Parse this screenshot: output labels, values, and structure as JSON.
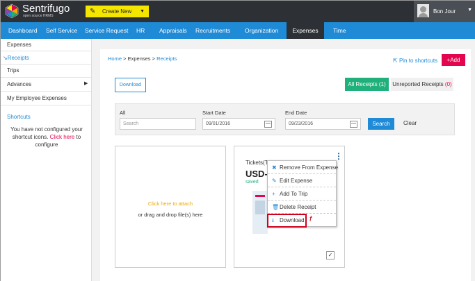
{
  "brand": {
    "name": "Sentrifugo",
    "tagline": "open source HRMS"
  },
  "header": {
    "create_label": "Create New",
    "user_name": "Bon Jour"
  },
  "nav": {
    "items": [
      "Dashboard",
      "Self Service",
      "Service Request",
      "HR",
      "Appraisals",
      "Recruitments",
      "Organization",
      "Expenses",
      "Time"
    ],
    "active": "Expenses"
  },
  "sidebar": {
    "items": [
      "Expenses",
      "Receipts",
      "Trips",
      "Advances",
      "My Employee Expenses"
    ],
    "active": "Receipts",
    "shortcuts_title": "Shortcuts",
    "shortcuts_text_1": "You have not configured your shortcut icons.",
    "shortcuts_link": "Click here",
    "shortcuts_text_2": "to configure"
  },
  "breadcrumb": {
    "home": "Home",
    "sep1": ">",
    "section": "Expenses",
    "sep2": ">",
    "current": "Receipts"
  },
  "actions": {
    "pin_label": "Pin to shortcuts",
    "add_label": "Add",
    "download_label": "Download"
  },
  "tabs": {
    "all_label": "All Receipts",
    "all_count": "(1)",
    "unreported_label": "Unreported Receipts",
    "unreported_count": "(0)"
  },
  "filter": {
    "all_label": "All",
    "search_placeholder": "Search",
    "start_label": "Start Date",
    "start_value": "09/01/2016",
    "end_label": "End Date",
    "end_value": "09/23/2016",
    "search_button": "Search",
    "clear_button": "Clear"
  },
  "dropzone": {
    "link_text": "Click here to attach",
    "hint_text": "or drag and drop file(s) here"
  },
  "receipt": {
    "category": "Tickets(T",
    "amount": "USD-1",
    "status": "saved"
  },
  "context_menu": {
    "items": [
      {
        "icon": "✖",
        "label": "Remove From Expense"
      },
      {
        "icon": "✎",
        "label": "Edit Expense"
      },
      {
        "icon": "+",
        "label": "Add To Trip"
      },
      {
        "icon": "🗑",
        "label": "Delete Receipt"
      },
      {
        "icon": "⭳",
        "label": "Download"
      }
    ]
  },
  "annotation": {
    "marker": "f"
  },
  "colors": {
    "nav_blue": "#1f8ad6",
    "topbar": "#2d3035",
    "accent_pink": "#e3064f",
    "create_yellow": "#f5e600",
    "success_green": "#20b07b"
  }
}
